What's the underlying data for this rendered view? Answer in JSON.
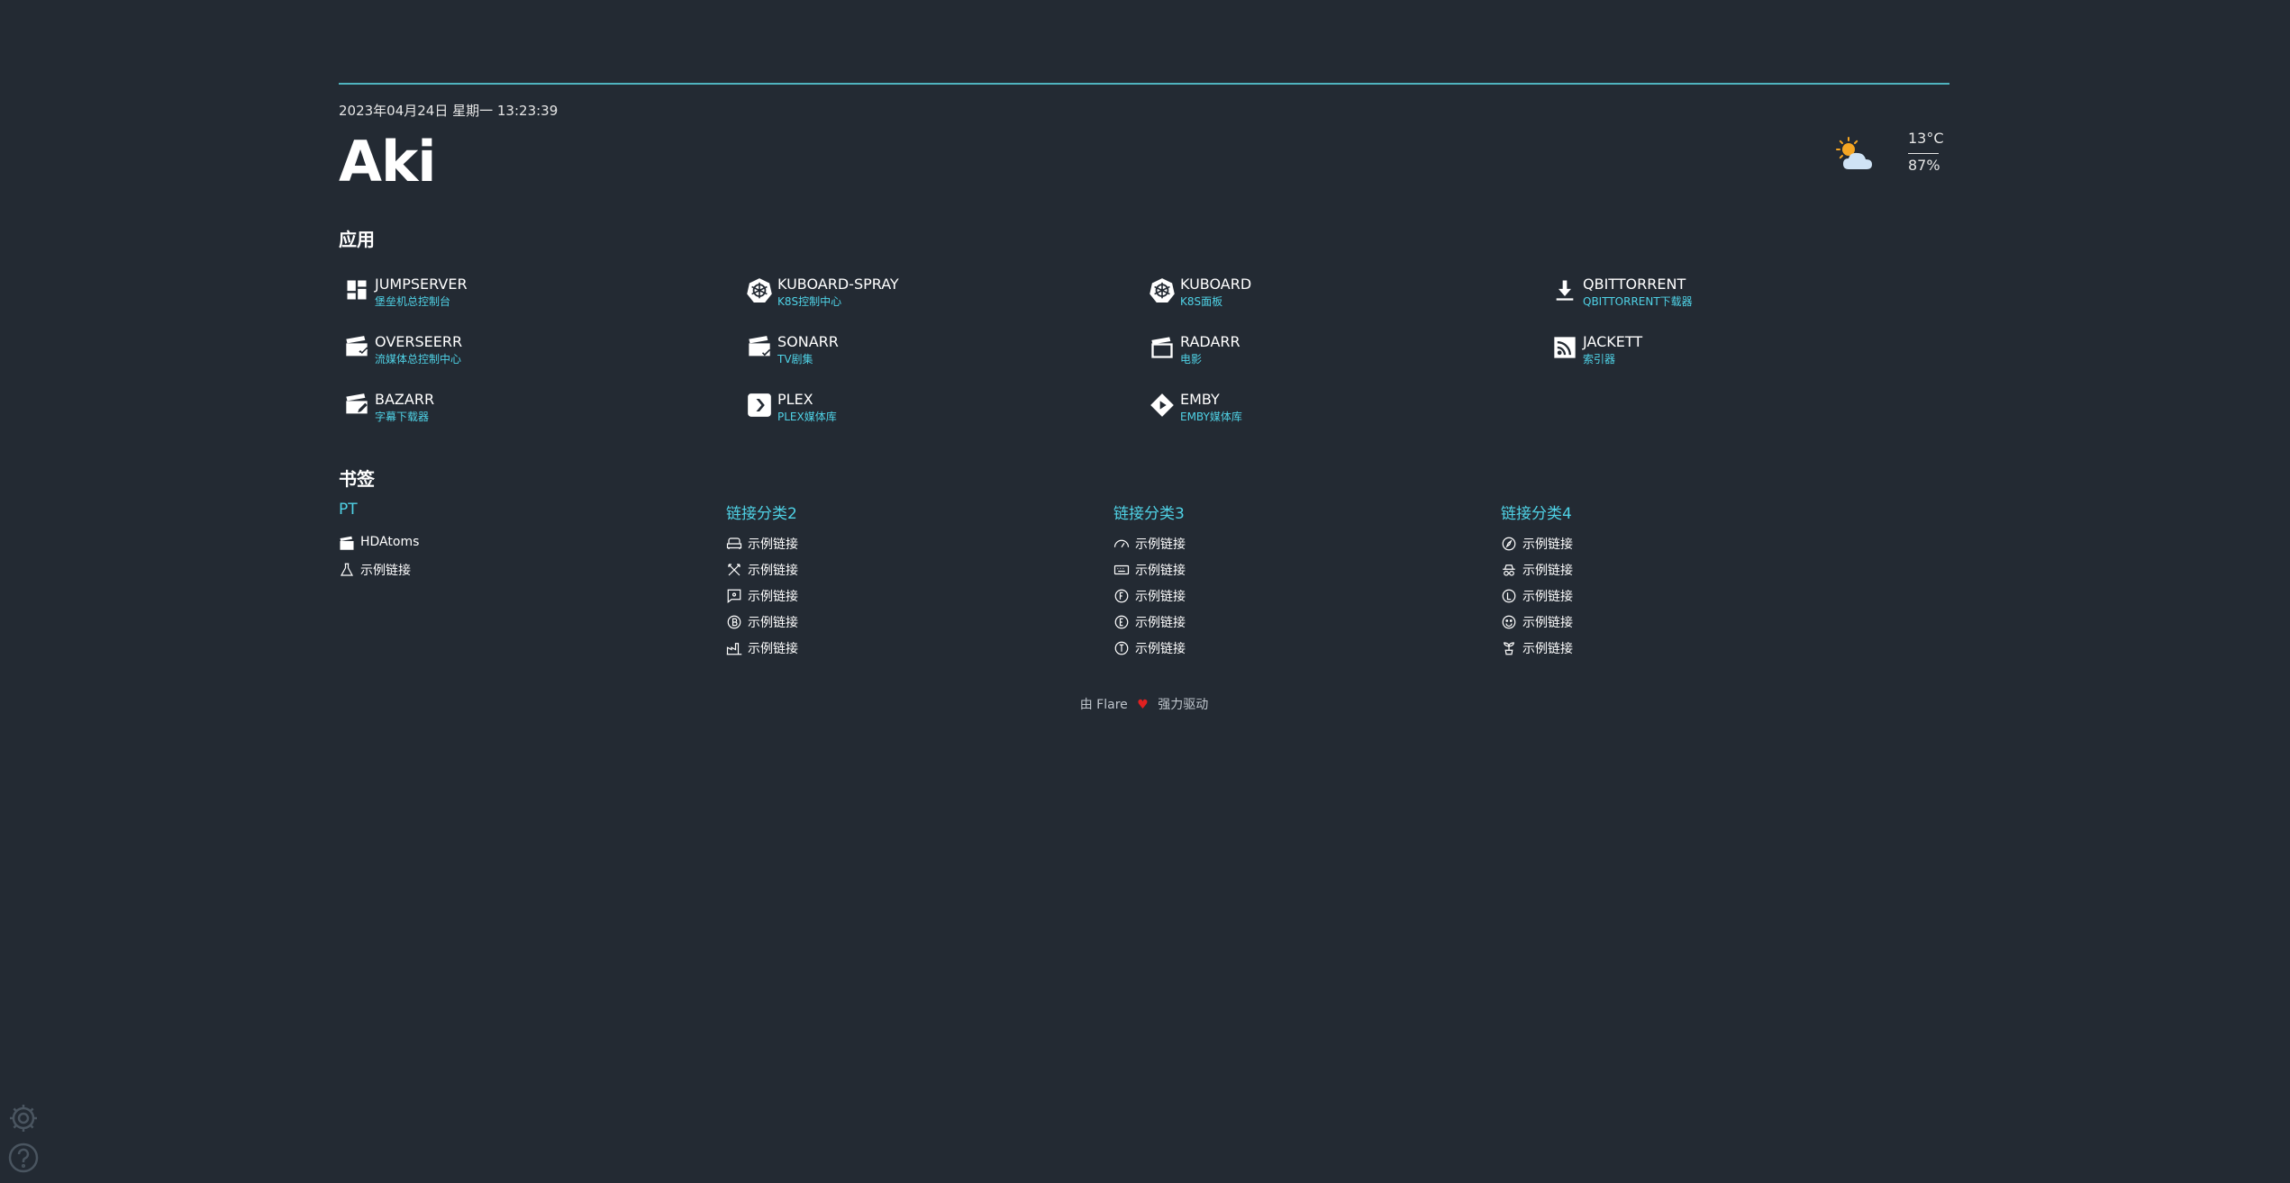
{
  "header": {
    "datetime": "2023年04月24日 星期一 13:23:39",
    "greeting": "Aki"
  },
  "weather": {
    "icon": "partly-cloudy-icon",
    "temperature": "13°C",
    "humidity": "87%"
  },
  "apps": {
    "title": "应用",
    "items": [
      {
        "name": "JUMPSERVER",
        "desc": "堡垒机总控制台",
        "icon": "dashboard-icon"
      },
      {
        "name": "KUBOARD-SPRAY",
        "desc": "K8S控制中心",
        "icon": "kubernetes-icon"
      },
      {
        "name": "KUBOARD",
        "desc": "K8S面板",
        "icon": "kubernetes-icon"
      },
      {
        "name": "QBITTORRENT",
        "desc": "QBITTORRENT下载器",
        "icon": "download-icon"
      },
      {
        "name": "OVERSEERR",
        "desc": "流媒体总控制中心",
        "icon": "movie-check-icon"
      },
      {
        "name": "SONARR",
        "desc": "TV剧集",
        "icon": "movie-check-icon"
      },
      {
        "name": "RADARR",
        "desc": "电影",
        "icon": "movie-open-icon"
      },
      {
        "name": "JACKETT",
        "desc": "索引器",
        "icon": "rss-icon"
      },
      {
        "name": "BAZARR",
        "desc": "字幕下载器",
        "icon": "movie-edit-icon"
      },
      {
        "name": "PLEX",
        "desc": "PLEX媒体库",
        "icon": "plex-icon"
      },
      {
        "name": "EMBY",
        "desc": "EMBY媒体库",
        "icon": "emby-icon"
      }
    ]
  },
  "bookmarks": {
    "title": "书签",
    "groups": [
      {
        "title": "PT",
        "items": [
          {
            "label": "HDAtoms",
            "icon": "movie-icon"
          },
          {
            "label": "示例链接",
            "icon": "flask-icon"
          }
        ]
      },
      {
        "title": "链接分类2",
        "items": [
          {
            "label": "示例链接",
            "icon": "sofa-icon"
          },
          {
            "label": "示例链接",
            "icon": "swords-icon"
          },
          {
            "label": "示例链接",
            "icon": "chat-icon"
          },
          {
            "label": "示例链接",
            "icon": "circle-letter-icon"
          },
          {
            "label": "示例链接",
            "icon": "factory-icon"
          }
        ]
      },
      {
        "title": "链接分类3",
        "items": [
          {
            "label": "示例链接",
            "icon": "gauge-icon"
          },
          {
            "label": "示例链接",
            "icon": "keyboard-icon"
          },
          {
            "label": "示例链接",
            "icon": "circle-letter-icon"
          },
          {
            "label": "示例链接",
            "icon": "circle-letter-icon"
          },
          {
            "label": "示例链接",
            "icon": "circle-letter-icon"
          }
        ]
      },
      {
        "title": "链接分类4",
        "items": [
          {
            "label": "示例链接",
            "icon": "compass-icon"
          },
          {
            "label": "示例链接",
            "icon": "spy-icon"
          },
          {
            "label": "示例链接",
            "icon": "circle-letter-icon"
          },
          {
            "label": "示例链接",
            "icon": "smiley-icon"
          },
          {
            "label": "示例链接",
            "icon": "plant-icon"
          }
        ]
      }
    ]
  },
  "footer": {
    "prefix": "由 Flare",
    "heart": "♥",
    "suffix": "强力驱动"
  },
  "corner": {
    "settings_icon": "gear-icon",
    "help_icon": "help-icon"
  },
  "colors": {
    "background": "#232a33",
    "accent": "#4fd2e6",
    "divider": "#4fb3bf",
    "heart": "#e02020"
  }
}
